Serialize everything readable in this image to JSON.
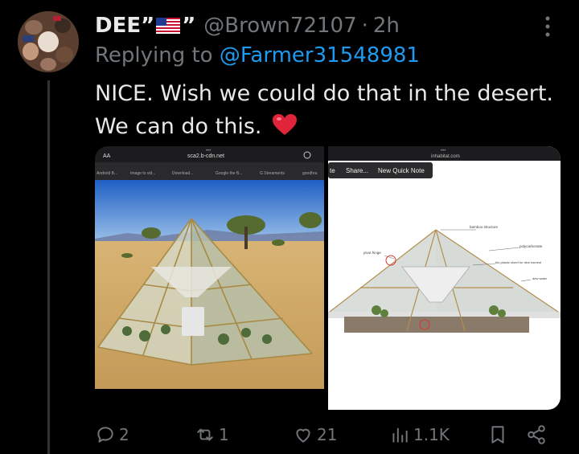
{
  "author": {
    "display_name": "DEE”",
    "name_suffix": "”",
    "handle": "@Brown72107",
    "separator": "·",
    "time": "2h"
  },
  "reply_to": {
    "prefix": "Replying to",
    "mention": "@Farmer31548981"
  },
  "tweet_text": "NICE. Wish we could do that in the desert. We can do this.",
  "media": {
    "left": {
      "status_dots": "•••",
      "reader_label": "AA",
      "url": "sca2.b-cdn.net",
      "bookmarks": [
        "Android B...",
        "Image to vid...",
        "Download...",
        "Google the B...",
        "G Streaments",
        "goodhra"
      ]
    },
    "right": {
      "status_dots": "•••",
      "url": "inhabitat.com",
      "menu": [
        "te",
        "Share...",
        "New Quick Note"
      ],
      "labels": [
        "bamboo structure",
        "polycarbonate",
        "bio plastic sheet for dew harvest",
        "dew water",
        "pivot hinge"
      ]
    }
  },
  "actions": {
    "replies": "2",
    "reposts": "1",
    "likes": "21",
    "views": "1.1K"
  },
  "colors": {
    "background": "#000000",
    "text": "#e7e9ea",
    "muted": "#71767b",
    "link": "#1d9bf0",
    "heart": "#e0243a"
  },
  "icons": [
    "flag-usa-icon",
    "more-icon",
    "heart-emoji-icon",
    "reply-icon",
    "repost-icon",
    "like-icon",
    "views-icon",
    "bookmark-icon",
    "share-icon"
  ]
}
